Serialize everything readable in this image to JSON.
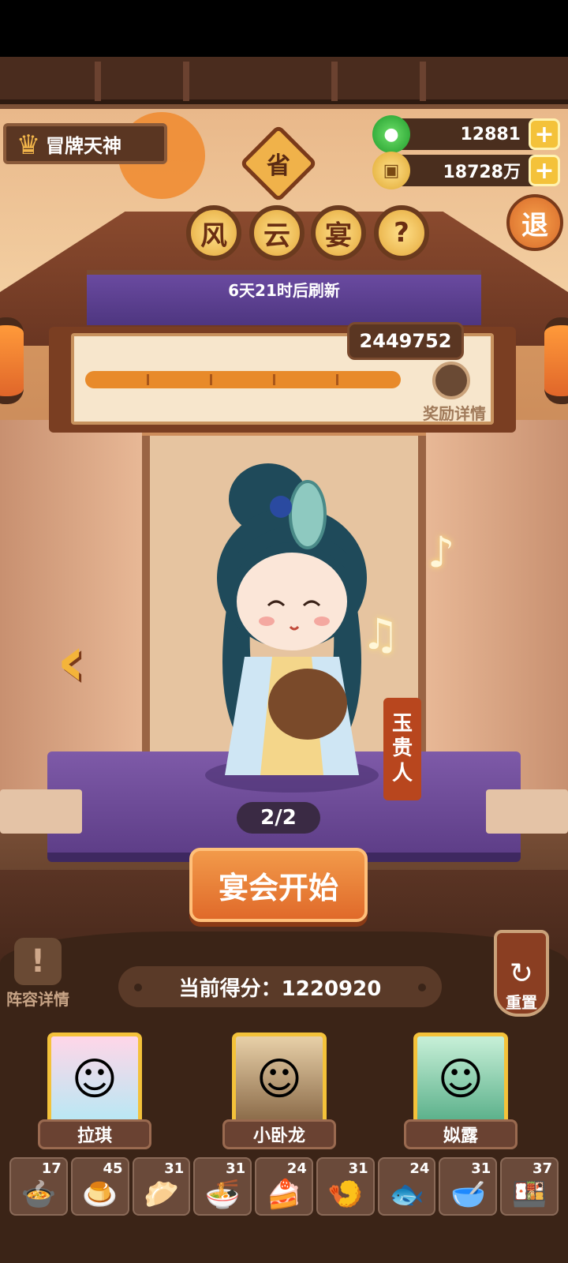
{
  "header": {
    "title_badge": "冒牌天神",
    "province_badge": "省",
    "jade": {
      "value": "12881",
      "icon": "jade-icon"
    },
    "coins": {
      "value": "18728万",
      "icon": "coin-icon"
    },
    "exit_label": "退"
  },
  "event": {
    "tiles": [
      "风",
      "云",
      "宴"
    ],
    "help_label": "?",
    "refresh_text": "6天21时后刷新"
  },
  "progress": {
    "target_score": "2449752",
    "reward_label": "奖励详情",
    "fraction": 0.0
  },
  "stage": {
    "character_name": [
      "玉",
      "贵",
      "人"
    ],
    "page_indicator": "2/2",
    "start_button": "宴会开始"
  },
  "bottom": {
    "lineup_label": "阵容详情",
    "reset_label": "重置",
    "current_score": "当前得分：1220920",
    "heroes": [
      {
        "name": "拉琪"
      },
      {
        "name": "小卧龙"
      },
      {
        "name": "姒露"
      }
    ],
    "dishes": [
      {
        "count": "17",
        "icon": "hotpot-icon"
      },
      {
        "count": "45",
        "icon": "tofu-icon"
      },
      {
        "count": "31",
        "icon": "dumpling-icon"
      },
      {
        "count": "31",
        "icon": "skewer-bowl-icon"
      },
      {
        "count": "24",
        "icon": "cake-icon"
      },
      {
        "count": "31",
        "icon": "shrimp-plate-icon"
      },
      {
        "count": "24",
        "icon": "fish-plate-icon"
      },
      {
        "count": "31",
        "icon": "soup-bowl-icon"
      },
      {
        "count": "37",
        "icon": "sushi-board-icon"
      }
    ]
  },
  "colors": {
    "accent": "#e06a2a",
    "gold": "#f4c23a",
    "panel": "#5a3622"
  }
}
